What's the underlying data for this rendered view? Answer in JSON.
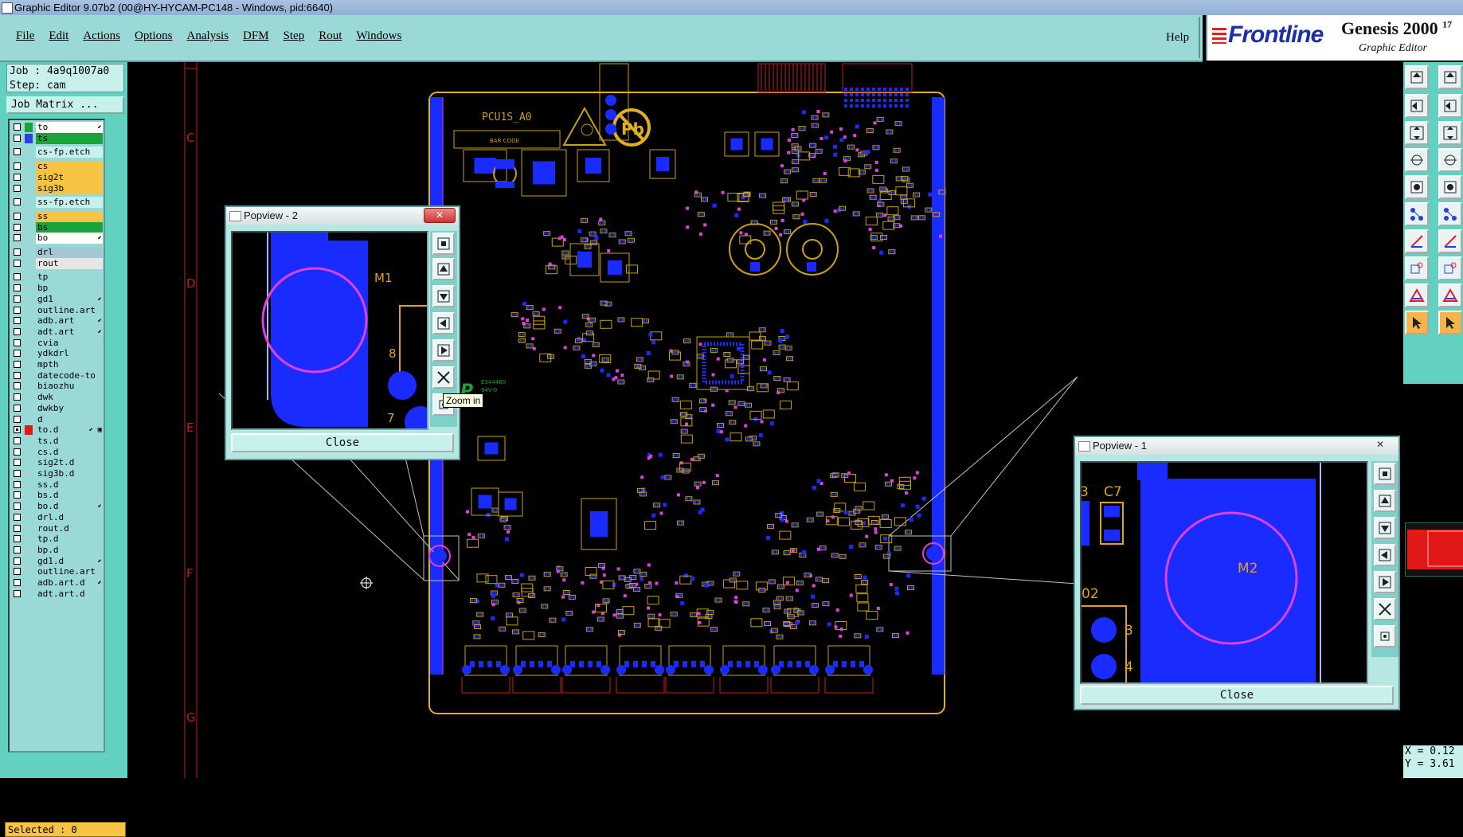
{
  "window": {
    "title": "Graphic Editor 9.07b2 (00@HY-HYCAM-PC148 - Windows, pid:6640)"
  },
  "menu": {
    "items": [
      "File",
      "Edit",
      "Actions",
      "Options",
      "Analysis",
      "DFM",
      "Step",
      "Rout",
      "Windows"
    ],
    "help": "Help"
  },
  "brand": {
    "logo": "Frontline",
    "product": "Genesis 2000",
    "version": "17",
    "subtitle": "Graphic Editor"
  },
  "job": {
    "job_line": "Job : 4a9q1007a0",
    "step_line": "Step: cam",
    "matrix_button": "Job Matrix ..."
  },
  "layers": [
    {
      "name": "to",
      "color": "#ffffff",
      "swatch": "#1aa33a",
      "arrow": "⬋"
    },
    {
      "name": "ts",
      "color": "#1aa33a",
      "swatch": "#2a3fe0",
      "arrow": ""
    },
    {
      "name": "cs-fp.etch",
      "color": "#c8f0ec",
      "swatch": "",
      "arrow": "",
      "gap": true
    },
    {
      "name": "cs",
      "color": "#f6c343",
      "swatch": "",
      "arrow": "",
      "gap": true
    },
    {
      "name": "sig2t",
      "color": "#f6c343",
      "swatch": "",
      "arrow": ""
    },
    {
      "name": "sig3b",
      "color": "#f6c343",
      "swatch": "",
      "arrow": ""
    },
    {
      "name": "ss-fp.etch",
      "color": "#c8f0ec",
      "swatch": "",
      "arrow": "",
      "gap": true
    },
    {
      "name": "ss",
      "color": "#f6c343",
      "swatch": "",
      "arrow": "",
      "gap": true
    },
    {
      "name": "bs",
      "color": "#1aa33a",
      "swatch": "",
      "arrow": ""
    },
    {
      "name": "bo",
      "color": "#ffffff",
      "swatch": "",
      "arrow": "⬋"
    },
    {
      "name": "drl",
      "color": "#a6c6d2",
      "swatch": "",
      "arrow": "",
      "gap": true
    },
    {
      "name": "rout",
      "color": "#e6e6e6",
      "swatch": "",
      "arrow": ""
    },
    {
      "name": "tp",
      "color": "#9bd9d6",
      "swatch": "",
      "arrow": "",
      "gap": true
    },
    {
      "name": "bp",
      "color": "#9bd9d6",
      "swatch": "",
      "arrow": ""
    },
    {
      "name": "gd1",
      "color": "#9bd9d6",
      "swatch": "",
      "arrow": "⬋"
    },
    {
      "name": "outline.art",
      "color": "#9bd9d6",
      "swatch": "",
      "arrow": ""
    },
    {
      "name": "adb.art",
      "color": "#9bd9d6",
      "swatch": "",
      "arrow": "⬋"
    },
    {
      "name": "adt.art",
      "color": "#9bd9d6",
      "swatch": "",
      "arrow": "⬋"
    },
    {
      "name": "cvia",
      "color": "#9bd9d6",
      "swatch": "",
      "arrow": ""
    },
    {
      "name": "ydkdrl",
      "color": "#9bd9d6",
      "swatch": "",
      "arrow": ""
    },
    {
      "name": "mpth",
      "color": "#9bd9d6",
      "swatch": "",
      "arrow": ""
    },
    {
      "name": "datecode-to",
      "color": "#9bd9d6",
      "swatch": "",
      "arrow": ""
    },
    {
      "name": "biaozhu",
      "color": "#9bd9d6",
      "swatch": "",
      "arrow": ""
    },
    {
      "name": "dwk",
      "color": "#9bd9d6",
      "swatch": "",
      "arrow": ""
    },
    {
      "name": "dwkby",
      "color": "#9bd9d6",
      "swatch": "",
      "arrow": ""
    },
    {
      "name": "d",
      "color": "#9bd9d6",
      "swatch": "",
      "arrow": ""
    },
    {
      "name": "to.d",
      "color": "#9bd9d6",
      "swatch": "#e01818",
      "arrow": "⬋ ▣",
      "checked": true
    },
    {
      "name": "ts.d",
      "color": "#9bd9d6",
      "swatch": "",
      "arrow": ""
    },
    {
      "name": "cs.d",
      "color": "#9bd9d6",
      "swatch": "",
      "arrow": ""
    },
    {
      "name": "sig2t.d",
      "color": "#9bd9d6",
      "swatch": "",
      "arrow": ""
    },
    {
      "name": "sig3b.d",
      "color": "#9bd9d6",
      "swatch": "",
      "arrow": ""
    },
    {
      "name": "ss.d",
      "color": "#9bd9d6",
      "swatch": "",
      "arrow": ""
    },
    {
      "name": "bs.d",
      "color": "#9bd9d6",
      "swatch": "",
      "arrow": ""
    },
    {
      "name": "bo.d",
      "color": "#9bd9d6",
      "swatch": "",
      "arrow": "⬋"
    },
    {
      "name": "drl.d",
      "color": "#9bd9d6",
      "swatch": "",
      "arrow": ""
    },
    {
      "name": "rout.d",
      "color": "#9bd9d6",
      "swatch": "",
      "arrow": ""
    },
    {
      "name": "tp.d",
      "color": "#9bd9d6",
      "swatch": "",
      "arrow": ""
    },
    {
      "name": "bp.d",
      "color": "#9bd9d6",
      "swatch": "",
      "arrow": ""
    },
    {
      "name": "gd1.d",
      "color": "#9bd9d6",
      "swatch": "",
      "arrow": "⬋"
    },
    {
      "name": "outline.art",
      "color": "#9bd9d6",
      "swatch": "",
      "arrow": ""
    },
    {
      "name": "adb.art.d",
      "color": "#9bd9d6",
      "swatch": "",
      "arrow": "⬋"
    },
    {
      "name": "adt.art.d",
      "color": "#9bd9d6",
      "swatch": "",
      "arrow": ""
    }
  ],
  "status": {
    "selected": "Selected : 0"
  },
  "coords": {
    "x": "X = 0.12",
    "y": "Y = 3.61"
  },
  "ruler": {
    "labels": [
      "C",
      "D",
      "E",
      "F",
      "G"
    ]
  },
  "board": {
    "name": "PCU1S_A0",
    "barcode": "BAR CODE",
    "logo_text1": "E344460",
    "logo_text2": "94V-0"
  },
  "popup2": {
    "title": "Popview - 2",
    "close": "Close",
    "labels": [
      "M1",
      "8",
      "7"
    ],
    "tooltip": "Zoom in"
  },
  "popup1": {
    "title": "Popview - 1",
    "close": "Close",
    "labels": [
      "3",
      "C7",
      "M2",
      "02",
      "3",
      "4"
    ]
  },
  "colors": {
    "panel": "#62d1bf",
    "menubar": "#9bd9d6",
    "copper": "#c8a010",
    "pad": "#1a2bff",
    "silk": "#e040e0",
    "outline": "#e0b020"
  }
}
